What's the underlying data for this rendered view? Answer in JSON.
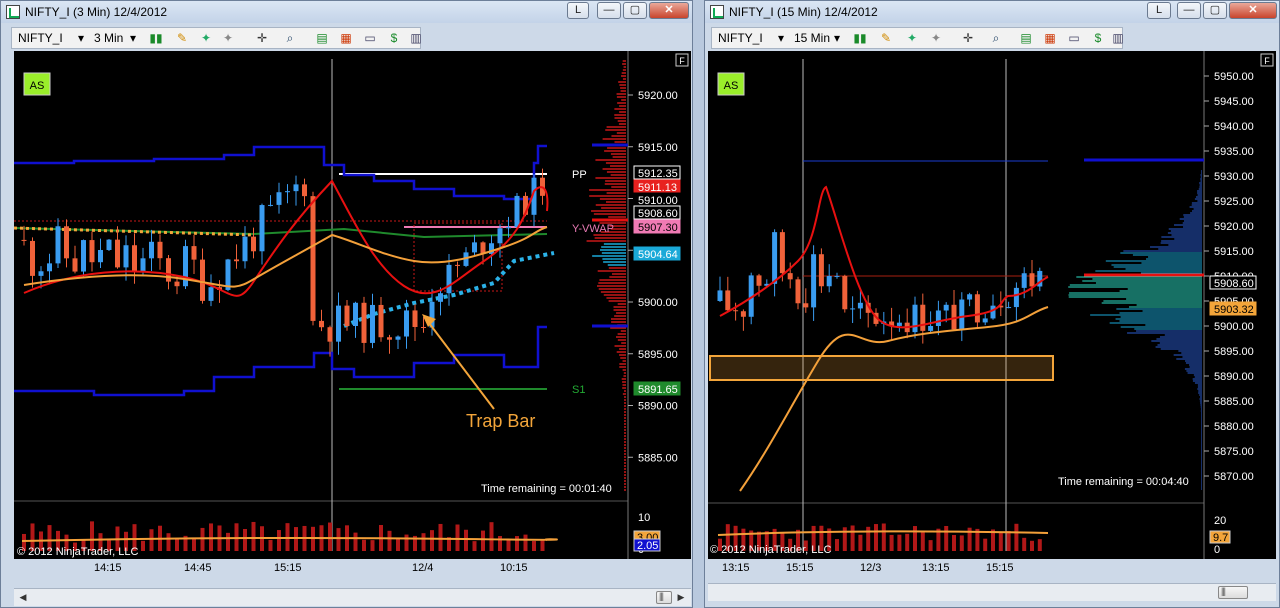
{
  "left": {
    "title": "NIFTY_I (3 Min)  12/4/2012",
    "instrument": "NIFTY_I",
    "interval": "3 Min",
    "as_badge": "AS",
    "f_badge": "F",
    "time_remaining": "Time remaining = 00:01:40",
    "copyright": "© 2012 NinjaTrader, LLC",
    "annotation": "Trap Bar",
    "price_ticks": [
      "5920.00",
      "5915.00",
      "5910.00",
      "5905.00",
      "5900.00",
      "5895.00",
      "5890.00",
      "5885.00"
    ],
    "price_labels": [
      {
        "text": "5912.35",
        "bg": "#000000",
        "fg": "#ffffff",
        "border": "#ffffff"
      },
      {
        "text": "5911.13",
        "bg": "#e8211f",
        "fg": "#ffffff",
        "border": "#e8211f"
      },
      {
        "text": "5910.00",
        "bg": "#000000",
        "fg": "#ffffff",
        "border": "#000000"
      },
      {
        "text": "5908.60",
        "bg": "#000000",
        "fg": "#ffffff",
        "border": "#ffffff"
      },
      {
        "text": "5907.30",
        "bg": "#f07ab4",
        "fg": "#000000",
        "border": "#f07ab4"
      },
      {
        "text": "5904.64",
        "bg": "#1aa9d8",
        "fg": "#ffffff",
        "border": "#1aa9d8"
      },
      {
        "text": "5891.65",
        "bg": "#1f8a2c",
        "fg": "#ffffff",
        "border": "#1f8a2c"
      }
    ],
    "level_labels": {
      "pp": "PP",
      "yvwap": "Y-VWAP",
      "s1": "S1"
    },
    "vol_ticks": [
      "10",
      "0"
    ],
    "vol_labels": [
      "3.00",
      "2.05"
    ],
    "x_ticks": [
      "14:15",
      "14:45",
      "15:15",
      "12/4",
      "10:15"
    ]
  },
  "right": {
    "title": "NIFTY_I (15 Min)  12/4/2012",
    "instrument": "NIFTY_I",
    "interval": "15 Min",
    "as_badge": "AS",
    "f_badge": "F",
    "time_remaining": "Time remaining = 00:04:40",
    "copyright": "© 2012 NinjaTrader, LLC",
    "price_ticks": [
      "5950.00",
      "5945.00",
      "5940.00",
      "5935.00",
      "5930.00",
      "5925.00",
      "5920.00",
      "5915.00",
      "5910.00",
      "5905.00",
      "5900.00",
      "5895.00",
      "5890.00",
      "5885.00",
      "5880.00",
      "5875.00",
      "5870.00"
    ],
    "price_labels": [
      {
        "text": "5908.60",
        "bg": "#000000",
        "fg": "#ffffff",
        "border": "#ffffff"
      },
      {
        "text": "5903.32",
        "bg": "#f3a53a",
        "fg": "#000000",
        "border": "#f3a53a"
      }
    ],
    "vol_ticks": [
      "20",
      "10",
      "0"
    ],
    "vol_labels": [
      "9.7"
    ],
    "x_ticks": [
      "13:15",
      "15:15",
      "12/3",
      "13:15",
      "15:15"
    ]
  },
  "window_buttons": {
    "layout": "L",
    "minimize": "—",
    "maximize": "▢",
    "close": "✕"
  },
  "colors": {
    "up": "#3a9cf0",
    "down": "#f0623a",
    "band": "#1010d0",
    "ma_red": "#e81010",
    "ma_orange": "#f3a03a",
    "dotted_cyan": "#2bb2e8"
  },
  "icons": [
    "candlestick-icon",
    "pencil-icon",
    "magnet-icon",
    "crosshair-icon",
    "zoom-icon",
    "strategy-icon",
    "indicator-icon",
    "chart-trader-icon",
    "dollar-icon",
    "properties-icon"
  ]
}
